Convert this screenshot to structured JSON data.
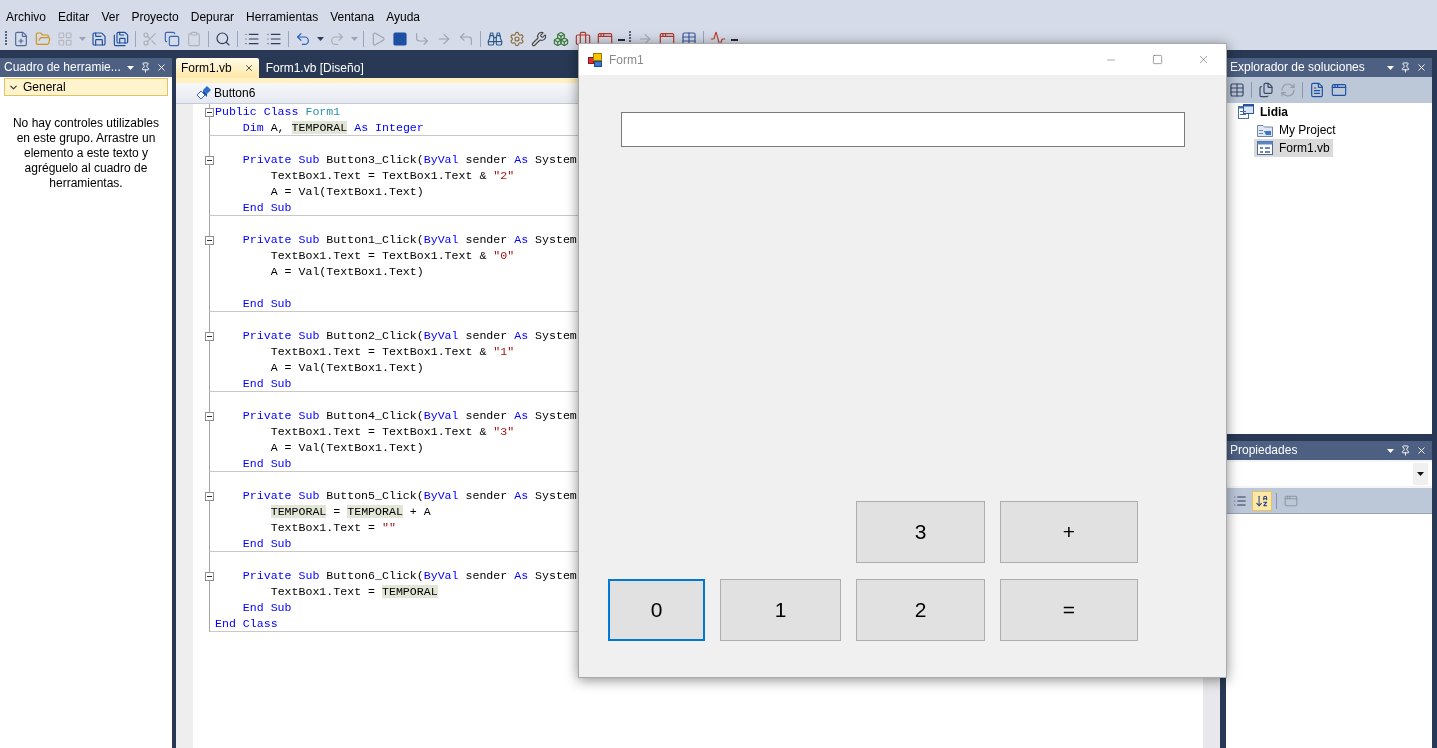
{
  "menu_bar": [
    "Archivo",
    "Editar",
    "Ver",
    "Proyecto",
    "Depurar",
    "Herramientas",
    "Ventana",
    "Ayuda"
  ],
  "toolbar": [
    {
      "kind": "grip"
    },
    {
      "kind": "button",
      "disabled": false
    },
    {
      "kind": "button",
      "disabled": false
    },
    {
      "kind": "button",
      "disabled": true
    },
    {
      "kind": "dropdown",
      "disabled": true
    },
    {
      "kind": "button",
      "disabled": false
    },
    {
      "kind": "button",
      "disabled": false
    },
    {
      "kind": "separator"
    },
    {
      "kind": "button",
      "disabled": true
    },
    {
      "kind": "button",
      "disabled": false
    },
    {
      "kind": "button",
      "disabled": true
    },
    {
      "kind": "separator"
    },
    {
      "kind": "button",
      "disabled": false
    },
    {
      "kind": "separator"
    },
    {
      "kind": "button",
      "disabled": false
    },
    {
      "kind": "button",
      "disabled": false
    },
    {
      "kind": "separator"
    },
    {
      "kind": "button",
      "disabled": false
    },
    {
      "kind": "dropdown",
      "disabled": false
    },
    {
      "kind": "button",
      "disabled": true
    },
    {
      "kind": "dropdown",
      "disabled": true
    },
    {
      "kind": "separator"
    },
    {
      "kind": "button",
      "disabled": true
    },
    {
      "kind": "button",
      "disabled": false
    },
    {
      "kind": "button",
      "disabled": true
    },
    {
      "kind": "button",
      "disabled": true
    },
    {
      "kind": "button",
      "disabled": true
    },
    {
      "kind": "separator"
    },
    {
      "kind": "button",
      "disabled": false
    },
    {
      "kind": "button",
      "disabled": false
    },
    {
      "kind": "button",
      "disabled": false
    },
    {
      "kind": "button",
      "disabled": false
    },
    {
      "kind": "button",
      "disabled": false
    },
    {
      "kind": "button",
      "disabled": false
    },
    {
      "kind": "overflow"
    },
    {
      "kind": "grip"
    },
    {
      "kind": "button",
      "disabled": true
    },
    {
      "kind": "button",
      "disabled": false
    },
    {
      "kind": "button",
      "disabled": false
    },
    {
      "kind": "separator"
    },
    {
      "kind": "button",
      "disabled": false
    },
    {
      "kind": "overflow"
    }
  ],
  "toolbox": {
    "title": "Cuadro de herramie...",
    "group": {
      "label": "General",
      "expanded": true
    },
    "message": "No hay controles utilizables en este grupo. Arrastre un elemento a este texto y agréguelo al cuadro de herramientas."
  },
  "editor": {
    "tabs": [
      {
        "label": "Form1.vb",
        "selected": true
      },
      {
        "label": "Form1.vb [Diseño]",
        "selected": false
      }
    ],
    "member": "Button6",
    "code": [
      {
        "kind": "code",
        "expanded": true,
        "tokens": [
          {
            "kind": "keyword",
            "text": "Public Class "
          },
          {
            "kind": "type",
            "text": "Form1"
          }
        ],
        "children": [
          {
            "kind": "code",
            "tokens": [
              {
                "kind": "keyword",
                "text": "Dim"
              },
              {
                "kind": "plain",
                "text": " A, "
              },
              {
                "kind": "highlight",
                "text": "TEMPORAL"
              },
              {
                "kind": "keyword",
                "text": " As Integer"
              }
            ]
          },
          {
            "kind": "blank"
          },
          {
            "kind": "code",
            "expanded": true,
            "tokens": [
              {
                "kind": "keyword",
                "text": "Private Sub"
              },
              {
                "kind": "plain",
                "text": " Button3_Click("
              },
              {
                "kind": "keyword",
                "text": "ByVal"
              },
              {
                "kind": "plain",
                "text": " sender "
              },
              {
                "kind": "keyword",
                "text": "As"
              },
              {
                "kind": "plain",
                "text": " System"
              }
            ],
            "children": [
              {
                "kind": "code",
                "tokens": [
                  {
                    "kind": "plain",
                    "text": "TextBox1.Text = TextBox1.Text & "
                  },
                  {
                    "kind": "string",
                    "text": "\"2\""
                  }
                ]
              },
              {
                "kind": "code",
                "tokens": [
                  {
                    "kind": "plain",
                    "text": "A = Val(TextBox1.Text)"
                  }
                ]
              }
            ]
          },
          {
            "kind": "code",
            "tokens": [
              {
                "kind": "keyword",
                "text": "End Sub"
              }
            ]
          },
          {
            "kind": "blank"
          },
          {
            "kind": "code",
            "expanded": true,
            "tokens": [
              {
                "kind": "keyword",
                "text": "Private Sub"
              },
              {
                "kind": "plain",
                "text": " Button1_Click("
              },
              {
                "kind": "keyword",
                "text": "ByVal"
              },
              {
                "kind": "plain",
                "text": " sender "
              },
              {
                "kind": "keyword",
                "text": "As"
              },
              {
                "kind": "plain",
                "text": " System"
              }
            ],
            "children": [
              {
                "kind": "code",
                "tokens": [
                  {
                    "kind": "plain",
                    "text": "TextBox1.Text = TextBox1.Text & "
                  },
                  {
                    "kind": "string",
                    "text": "\"0\""
                  }
                ]
              },
              {
                "kind": "code",
                "tokens": [
                  {
                    "kind": "plain",
                    "text": "A = Val(TextBox1.Text)"
                  }
                ]
              },
              {
                "kind": "blank"
              }
            ]
          },
          {
            "kind": "code",
            "tokens": [
              {
                "kind": "keyword",
                "text": "End Sub"
              }
            ]
          },
          {
            "kind": "blank"
          },
          {
            "kind": "code",
            "expanded": true,
            "tokens": [
              {
                "kind": "keyword",
                "text": "Private Sub"
              },
              {
                "kind": "plain",
                "text": " Button2_Click("
              },
              {
                "kind": "keyword",
                "text": "ByVal"
              },
              {
                "kind": "plain",
                "text": " sender "
              },
              {
                "kind": "keyword",
                "text": "As"
              },
              {
                "kind": "plain",
                "text": " System"
              }
            ],
            "children": [
              {
                "kind": "code",
                "tokens": [
                  {
                    "kind": "plain",
                    "text": "TextBox1.Text = TextBox1.Text & "
                  },
                  {
                    "kind": "string",
                    "text": "\"1\""
                  }
                ]
              },
              {
                "kind": "code",
                "tokens": [
                  {
                    "kind": "plain",
                    "text": "A = Val(TextBox1.Text)"
                  }
                ]
              }
            ]
          },
          {
            "kind": "code",
            "tokens": [
              {
                "kind": "keyword",
                "text": "End Sub"
              }
            ]
          },
          {
            "kind": "blank"
          },
          {
            "kind": "code",
            "expanded": true,
            "tokens": [
              {
                "kind": "keyword",
                "text": "Private Sub"
              },
              {
                "kind": "plain",
                "text": " Button4_Click("
              },
              {
                "kind": "keyword",
                "text": "ByVal"
              },
              {
                "kind": "plain",
                "text": " sender "
              },
              {
                "kind": "keyword",
                "text": "As"
              },
              {
                "kind": "plain",
                "text": " System"
              }
            ],
            "children": [
              {
                "kind": "code",
                "tokens": [
                  {
                    "kind": "plain",
                    "text": "TextBox1.Text = TextBox1.Text & "
                  },
                  {
                    "kind": "string",
                    "text": "\"3\""
                  }
                ]
              },
              {
                "kind": "code",
                "tokens": [
                  {
                    "kind": "plain",
                    "text": "A = Val(TextBox1.Text)"
                  }
                ]
              }
            ]
          },
          {
            "kind": "code",
            "tokens": [
              {
                "kind": "keyword",
                "text": "End Sub"
              }
            ]
          },
          {
            "kind": "blank"
          },
          {
            "kind": "code",
            "expanded": true,
            "tokens": [
              {
                "kind": "keyword",
                "text": "Private Sub"
              },
              {
                "kind": "plain",
                "text": " Button5_Click("
              },
              {
                "kind": "keyword",
                "text": "ByVal"
              },
              {
                "kind": "plain",
                "text": " sender "
              },
              {
                "kind": "keyword",
                "text": "As"
              },
              {
                "kind": "plain",
                "text": " System"
              }
            ],
            "children": [
              {
                "kind": "code",
                "tokens": [
                  {
                    "kind": "highlight",
                    "text": "TEMPORAL"
                  },
                  {
                    "kind": "plain",
                    "text": " = "
                  },
                  {
                    "kind": "highlight",
                    "text": "TEMPORAL"
                  },
                  {
                    "kind": "plain",
                    "text": " + A"
                  }
                ]
              },
              {
                "kind": "code",
                "tokens": [
                  {
                    "kind": "plain",
                    "text": "TextBox1.Text = "
                  },
                  {
                    "kind": "string",
                    "text": "\"\""
                  }
                ]
              }
            ]
          },
          {
            "kind": "code",
            "tokens": [
              {
                "kind": "keyword",
                "text": "End Sub"
              }
            ]
          },
          {
            "kind": "blank"
          },
          {
            "kind": "code",
            "expanded": true,
            "tokens": [
              {
                "kind": "keyword",
                "text": "Private Sub"
              },
              {
                "kind": "plain",
                "text": " Button6_Click("
              },
              {
                "kind": "keyword",
                "text": "ByVal"
              },
              {
                "kind": "plain",
                "text": " sender "
              },
              {
                "kind": "keyword",
                "text": "As"
              },
              {
                "kind": "plain",
                "text": " System"
              }
            ],
            "children": [
              {
                "kind": "code",
                "tokens": [
                  {
                    "kind": "plain",
                    "text": "TextBox1.Text = "
                  },
                  {
                    "kind": "highlight",
                    "text": "TEMPORAL"
                  }
                ]
              }
            ]
          },
          {
            "kind": "code",
            "tokens": [
              {
                "kind": "keyword",
                "text": "End Sub"
              }
            ]
          }
        ]
      },
      {
        "kind": "code",
        "tokens": [
          {
            "kind": "keyword",
            "text": "End Class"
          }
        ]
      }
    ]
  },
  "solution_explorer": {
    "title": "Explorador de soluciones",
    "toolbar": [
      {
        "kind": "button",
        "disabled": false
      },
      {
        "kind": "separator"
      },
      {
        "kind": "button",
        "disabled": false
      },
      {
        "kind": "button",
        "disabled": true
      },
      {
        "kind": "separator"
      },
      {
        "kind": "button",
        "disabled": false
      },
      {
        "kind": "button",
        "disabled": false
      }
    ],
    "tree": [
      {
        "label": "Lidia",
        "kind": "project",
        "selected": false,
        "children": [
          {
            "label": "My Project",
            "kind": "folder",
            "selected": false
          },
          {
            "label": "Form1.vb",
            "kind": "form",
            "selected": true
          }
        ]
      }
    ]
  },
  "properties": {
    "title": "Propiedades",
    "toolbar": [
      {
        "kind": "button",
        "selected": false,
        "disabled": false
      },
      {
        "kind": "button",
        "selected": true,
        "disabled": false
      },
      {
        "kind": "separator"
      },
      {
        "kind": "button",
        "selected": false,
        "disabled": true
      }
    ]
  },
  "form_window": {
    "title": "Form1",
    "button_rows": [
      [
        {
          "label": "3",
          "focused": false
        },
        {
          "label": "+",
          "focused": false
        }
      ],
      [
        {
          "label": "0",
          "focused": true
        },
        {
          "label": "1",
          "focused": false
        },
        {
          "label": "2",
          "focused": false
        },
        {
          "label": "=",
          "focused": false
        }
      ]
    ]
  }
}
